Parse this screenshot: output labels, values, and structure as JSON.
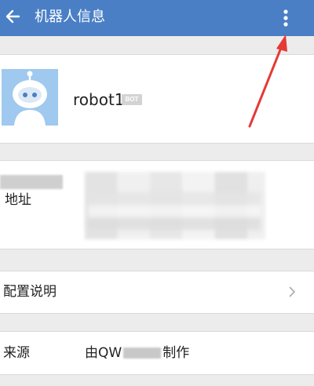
{
  "header": {
    "title": "机器人信息",
    "back_icon": "back-arrow-icon",
    "more_icon": "more-vertical-icon",
    "bar_color": "#4a7fc6"
  },
  "profile": {
    "name": "robot1",
    "badge": "BOT",
    "avatar_icon": "robot-avatar-icon"
  },
  "address": {
    "label": "地址"
  },
  "config": {
    "label": "配置说明",
    "chevron_icon": "chevron-right-icon"
  },
  "source": {
    "label": "来源",
    "value_prefix": "由QW",
    "value_suffix": "制作"
  },
  "annotation": {
    "color": "#e53935",
    "icon": "red-arrow-annotation"
  }
}
